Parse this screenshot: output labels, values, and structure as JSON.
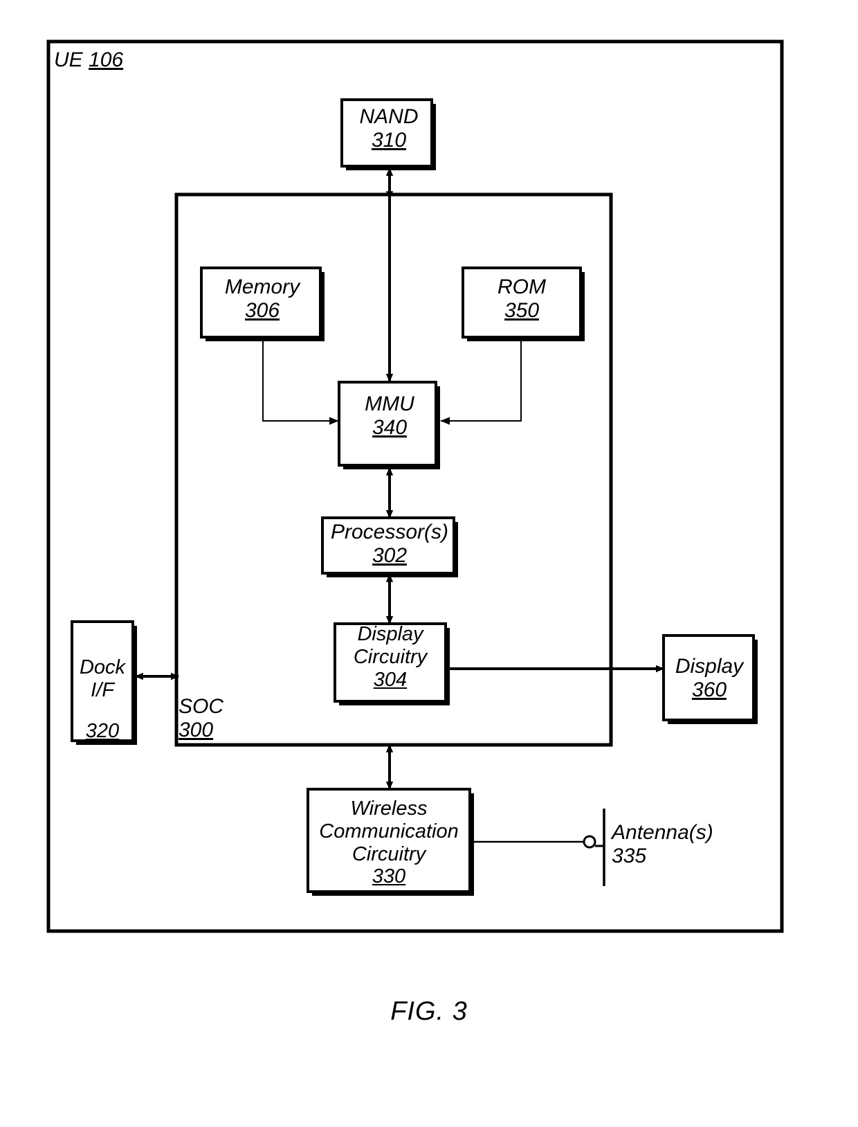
{
  "figure": {
    "caption": "FIG. 3",
    "outer_label": {
      "name": "UE",
      "ref": "106"
    }
  },
  "blocks": {
    "nand": {
      "name": "NAND",
      "ref": "310"
    },
    "memory": {
      "name": "Memory",
      "ref": "306"
    },
    "rom": {
      "name": "ROM",
      "ref": "350"
    },
    "mmu": {
      "name": "MMU",
      "ref": "340"
    },
    "processor": {
      "name": "Processor(s)",
      "ref": "302"
    },
    "display_circuitry": {
      "name": "Display\nCircuitry",
      "ref": "304"
    },
    "dock_if": {
      "name": "Dock\nI/F",
      "ref": "320"
    },
    "soc": {
      "name": "SOC",
      "ref": "300"
    },
    "display": {
      "name": "Display",
      "ref": "360"
    },
    "wireless_comm": {
      "name": "Wireless\nCommunication\nCircuitry",
      "ref": "330"
    },
    "antenna": {
      "name": "Antenna(s)",
      "ref": "335"
    }
  },
  "connections": [
    {
      "from": "soc",
      "to": "nand",
      "arrow": "both"
    },
    {
      "from": "nand",
      "to": "mmu",
      "arrow": "down"
    },
    {
      "from": "mmu",
      "to": "memory",
      "arrow": "both"
    },
    {
      "from": "mmu",
      "to": "rom",
      "arrow": "both"
    },
    {
      "from": "mmu",
      "to": "processor",
      "arrow": "both"
    },
    {
      "from": "processor",
      "to": "display_circuitry",
      "arrow": "both"
    },
    {
      "from": "dock_if",
      "to": "soc",
      "arrow": "both"
    },
    {
      "from": "display_circuitry",
      "to": "display",
      "arrow": "right"
    },
    {
      "from": "soc",
      "to": "wireless_comm",
      "arrow": "both"
    },
    {
      "from": "wireless_comm",
      "to": "antenna",
      "arrow": "none"
    }
  ],
  "style": {
    "stroke": "#000000",
    "fill": "#ffffff",
    "thin_stroke_width": 2,
    "thick_stroke_width": 5
  }
}
